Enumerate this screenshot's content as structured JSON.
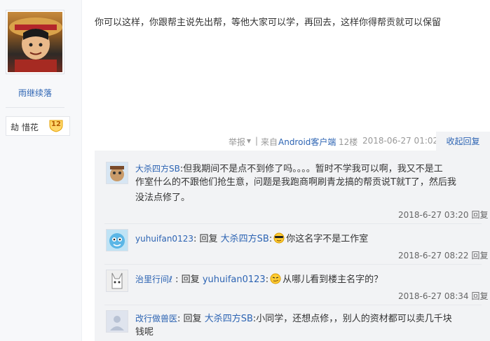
{
  "author": {
    "name": "雨继续落",
    "badge_name": "劫 惜花",
    "badge_level": "12"
  },
  "post": {
    "content": "你可以这样，你跟帮主说先出帮，等他大家可以学，再回去，这样你得帮贡就可以保留",
    "report": "举报",
    "from_label": "来自",
    "platform": "Android客户端",
    "floor": "12楼",
    "datetime": "2018-06-27 01:02",
    "collapse_reply": "收起回复"
  },
  "replies": [
    {
      "user": "大杀四方SB",
      "text_line1": "但我期间不是点不到修了吗。。。。暂时不学我可以啊，我又不是工",
      "text_line2": "作室什么的不跟他们抢生意，问题是我跑商啊刷青龙搞的帮贡说T就T了，然后我",
      "text_line3": "没法点修了。",
      "time": "2018-6-27 03:20",
      "reply_label": "回复"
    },
    {
      "user": "yuhuifan0123",
      "reply_word": "回复",
      "target": "大杀四方SB",
      "text": "你这名字不是工作室",
      "time": "2018-6-27 08:22",
      "reply_label": "回复"
    },
    {
      "user": "治里行间",
      "user_icon_char": "ℓ",
      "reply_word": "回复",
      "target": "yuhuifan0123",
      "text": "从哪儿看到楼主名字的？",
      "time": "2018-6-27 08:34",
      "reply_label": "回复"
    },
    {
      "user": "改行做兽医",
      "reply_word": "回复",
      "target": "大杀四方SB",
      "text_line1": "小同学，还想点修，，别人的资材都可以卖几千块",
      "text_line2": "钱呢"
    }
  ]
}
